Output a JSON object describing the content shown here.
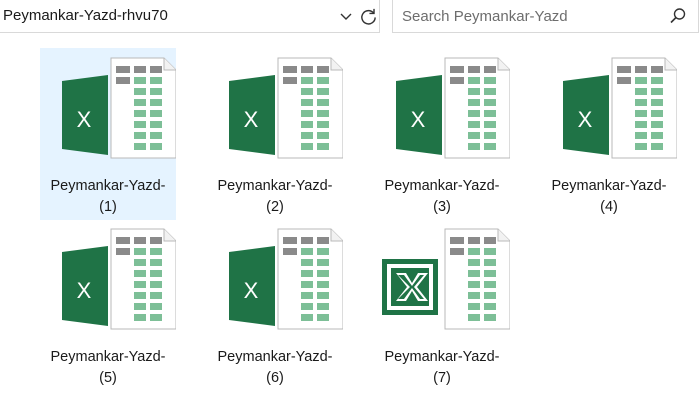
{
  "address_bar": {
    "path": "Peymankar-Yazd-rhvu70",
    "dropdown_icon": "chevron-down-icon",
    "refresh_icon": "refresh-icon"
  },
  "search": {
    "placeholder": "Search Peymankar-Yazd-",
    "icon": "search-icon"
  },
  "files": [
    {
      "name_line1": "Peymankar-Yazd-",
      "name_line2": "(1)",
      "selected": true,
      "icon": "excel-file-icon"
    },
    {
      "name_line1": "Peymankar-Yazd-",
      "name_line2": "(2)",
      "selected": false,
      "icon": "excel-file-icon"
    },
    {
      "name_line1": "Peymankar-Yazd-",
      "name_line2": "(3)",
      "selected": false,
      "icon": "excel-file-icon"
    },
    {
      "name_line1": "Peymankar-Yazd-",
      "name_line2": "(4)",
      "selected": false,
      "icon": "excel-file-icon"
    },
    {
      "name_line1": "Peymankar-Yazd-",
      "name_line2": "(5)",
      "selected": false,
      "icon": "excel-file-icon"
    },
    {
      "name_line1": "Peymankar-Yazd-",
      "name_line2": "(6)",
      "selected": false,
      "icon": "excel-file-icon"
    },
    {
      "name_line1": "Peymankar-Yazd-",
      "name_line2": "(7)",
      "selected": false,
      "icon": "excel-legacy-file-icon"
    }
  ],
  "colors": {
    "excel_green": "#1f7346",
    "sheet_green": "#7dbf97",
    "sheet_gray": "#8a8a8a",
    "selection": "#e5f3ff"
  }
}
